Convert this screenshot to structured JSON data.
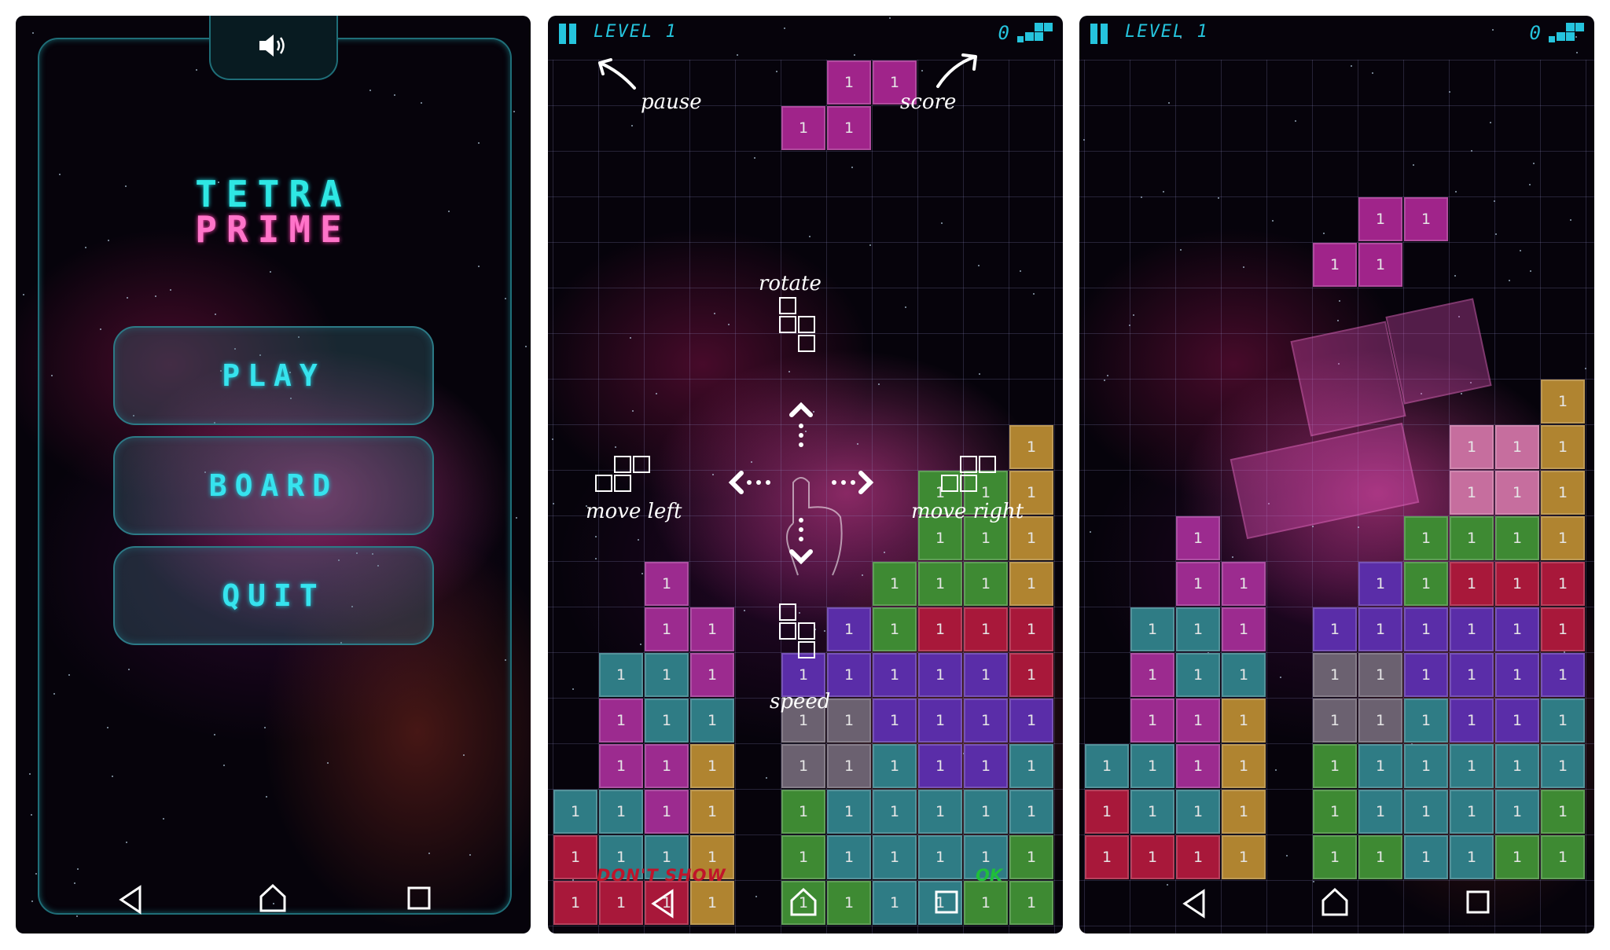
{
  "menu": {
    "title_top": "TETRA",
    "title_bottom": "PRIME",
    "buttons": [
      "PLAY",
      "BOARD",
      "QUIT"
    ]
  },
  "hud": {
    "level": "LEVEL 1",
    "score": "0"
  },
  "tutorial": {
    "pause": "pause",
    "score": "score",
    "rotate": "rotate",
    "move_left": "move left",
    "move_right": "move right",
    "speed": "speed",
    "dont_show": "DON'T SHOW",
    "ok": "OK"
  },
  "block_label": "1",
  "colors": {
    "accent": "#2ee7e4",
    "title_pink": "#ff74c9",
    "hud_cyan": "#25c4dd",
    "dont_show_red": "#c0142a",
    "ok_green": "#1fbf3a"
  },
  "icons": [
    "speaker-icon",
    "back-icon",
    "home-icon",
    "recents-icon",
    "pause-icon",
    "tetromino-logo-icon"
  ],
  "boards": {
    "tutorial": {
      "falling": [
        [
          6,
          1,
          "m"
        ],
        [
          7,
          1,
          "m"
        ],
        [
          5,
          2,
          "m"
        ],
        [
          6,
          2,
          "m"
        ]
      ],
      "cells": [
        [
          2,
          12,
          "p"
        ],
        [
          2,
          13,
          "p"
        ],
        [
          3,
          13,
          "p"
        ],
        [
          1,
          14,
          "t"
        ],
        [
          2,
          14,
          "t"
        ],
        [
          3,
          14,
          "p"
        ],
        [
          1,
          15,
          "p"
        ],
        [
          2,
          15,
          "t"
        ],
        [
          3,
          15,
          "t"
        ],
        [
          1,
          16,
          "p"
        ],
        [
          2,
          16,
          "p"
        ],
        [
          3,
          16,
          "o"
        ],
        [
          0,
          17,
          "t"
        ],
        [
          1,
          17,
          "t"
        ],
        [
          2,
          17,
          "p"
        ],
        [
          3,
          17,
          "o"
        ],
        [
          0,
          18,
          "r"
        ],
        [
          1,
          18,
          "t"
        ],
        [
          2,
          18,
          "t"
        ],
        [
          3,
          18,
          "o"
        ],
        [
          0,
          19,
          "r"
        ],
        [
          1,
          19,
          "r"
        ],
        [
          2,
          19,
          "r"
        ],
        [
          3,
          19,
          "o"
        ],
        [
          10,
          9,
          "o"
        ],
        [
          10,
          10,
          "o"
        ],
        [
          8,
          10,
          "g"
        ],
        [
          9,
          10,
          "g"
        ],
        [
          8,
          11,
          "g"
        ],
        [
          9,
          11,
          "g"
        ],
        [
          10,
          11,
          "o"
        ],
        [
          7,
          12,
          "g"
        ],
        [
          8,
          12,
          "g"
        ],
        [
          9,
          12,
          "g"
        ],
        [
          10,
          12,
          "o"
        ],
        [
          6,
          13,
          "v"
        ],
        [
          7,
          13,
          "g"
        ],
        [
          8,
          13,
          "r"
        ],
        [
          9,
          13,
          "r"
        ],
        [
          10,
          13,
          "r"
        ],
        [
          5,
          14,
          "v"
        ],
        [
          6,
          14,
          "v"
        ],
        [
          7,
          14,
          "v"
        ],
        [
          8,
          14,
          "v"
        ],
        [
          9,
          14,
          "v"
        ],
        [
          10,
          14,
          "r"
        ],
        [
          5,
          15,
          "gr"
        ],
        [
          6,
          15,
          "gr"
        ],
        [
          7,
          15,
          "v"
        ],
        [
          8,
          15,
          "v"
        ],
        [
          9,
          15,
          "v"
        ],
        [
          10,
          15,
          "v"
        ],
        [
          5,
          16,
          "gr"
        ],
        [
          6,
          16,
          "gr"
        ],
        [
          7,
          16,
          "t"
        ],
        [
          8,
          16,
          "v"
        ],
        [
          9,
          16,
          "v"
        ],
        [
          10,
          16,
          "t"
        ],
        [
          5,
          17,
          "g"
        ],
        [
          6,
          17,
          "t"
        ],
        [
          7,
          17,
          "t"
        ],
        [
          8,
          17,
          "t"
        ],
        [
          9,
          17,
          "t"
        ],
        [
          10,
          17,
          "t"
        ],
        [
          5,
          18,
          "g"
        ],
        [
          6,
          18,
          "t"
        ],
        [
          7,
          18,
          "t"
        ],
        [
          8,
          18,
          "t"
        ],
        [
          9,
          18,
          "t"
        ],
        [
          10,
          18,
          "g"
        ],
        [
          5,
          19,
          "g"
        ],
        [
          6,
          19,
          "g"
        ],
        [
          7,
          19,
          "t"
        ],
        [
          8,
          19,
          "t"
        ],
        [
          9,
          19,
          "g"
        ],
        [
          10,
          19,
          "g"
        ]
      ]
    },
    "game": {
      "falling": [
        [
          6,
          4,
          "m"
        ],
        [
          7,
          4,
          "m"
        ],
        [
          5,
          5,
          "m"
        ],
        [
          6,
          5,
          "m"
        ]
      ],
      "cells": [
        [
          2,
          11,
          "p"
        ],
        [
          2,
          12,
          "p"
        ],
        [
          3,
          12,
          "p"
        ],
        [
          1,
          13,
          "t"
        ],
        [
          2,
          13,
          "t"
        ],
        [
          3,
          13,
          "p"
        ],
        [
          1,
          14,
          "p"
        ],
        [
          2,
          14,
          "t"
        ],
        [
          3,
          14,
          "t"
        ],
        [
          1,
          15,
          "p"
        ],
        [
          2,
          15,
          "p"
        ],
        [
          3,
          15,
          "o"
        ],
        [
          0,
          16,
          "t"
        ],
        [
          1,
          16,
          "t"
        ],
        [
          2,
          16,
          "p"
        ],
        [
          3,
          16,
          "o"
        ],
        [
          0,
          17,
          "r"
        ],
        [
          1,
          17,
          "t"
        ],
        [
          2,
          17,
          "t"
        ],
        [
          3,
          17,
          "o"
        ],
        [
          0,
          18,
          "r"
        ],
        [
          1,
          18,
          "r"
        ],
        [
          2,
          18,
          "r"
        ],
        [
          3,
          18,
          "o"
        ],
        [
          10,
          8,
          "o"
        ],
        [
          10,
          9,
          "o"
        ],
        [
          8,
          9,
          "pk"
        ],
        [
          9,
          9,
          "pk"
        ],
        [
          8,
          10,
          "pk"
        ],
        [
          9,
          10,
          "pk"
        ],
        [
          10,
          10,
          "o"
        ],
        [
          7,
          11,
          "g"
        ],
        [
          8,
          11,
          "g"
        ],
        [
          9,
          11,
          "g"
        ],
        [
          10,
          11,
          "o"
        ],
        [
          6,
          12,
          "v"
        ],
        [
          7,
          12,
          "g"
        ],
        [
          8,
          12,
          "r"
        ],
        [
          9,
          12,
          "r"
        ],
        [
          10,
          12,
          "r"
        ],
        [
          5,
          13,
          "v"
        ],
        [
          6,
          13,
          "v"
        ],
        [
          7,
          13,
          "v"
        ],
        [
          8,
          13,
          "v"
        ],
        [
          9,
          13,
          "v"
        ],
        [
          10,
          13,
          "r"
        ],
        [
          5,
          14,
          "gr"
        ],
        [
          6,
          14,
          "gr"
        ],
        [
          7,
          14,
          "v"
        ],
        [
          8,
          14,
          "v"
        ],
        [
          9,
          14,
          "v"
        ],
        [
          10,
          14,
          "v"
        ],
        [
          5,
          15,
          "gr"
        ],
        [
          6,
          15,
          "gr"
        ],
        [
          7,
          15,
          "t"
        ],
        [
          8,
          15,
          "v"
        ],
        [
          9,
          15,
          "v"
        ],
        [
          10,
          15,
          "t"
        ],
        [
          5,
          16,
          "g"
        ],
        [
          6,
          16,
          "t"
        ],
        [
          7,
          16,
          "t"
        ],
        [
          8,
          16,
          "t"
        ],
        [
          9,
          16,
          "t"
        ],
        [
          10,
          16,
          "t"
        ],
        [
          5,
          17,
          "g"
        ],
        [
          6,
          17,
          "t"
        ],
        [
          7,
          17,
          "t"
        ],
        [
          8,
          17,
          "t"
        ],
        [
          9,
          17,
          "t"
        ],
        [
          10,
          17,
          "g"
        ],
        [
          5,
          18,
          "g"
        ],
        [
          6,
          18,
          "g"
        ],
        [
          7,
          18,
          "t"
        ],
        [
          8,
          18,
          "t"
        ],
        [
          9,
          18,
          "g"
        ],
        [
          10,
          18,
          "g"
        ]
      ]
    }
  }
}
